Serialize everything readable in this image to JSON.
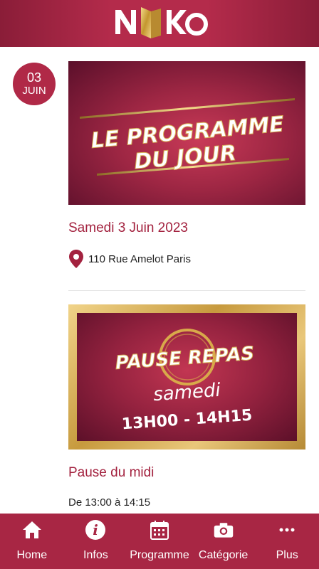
{
  "header": {
    "logo_text": "NIKO",
    "brand_color": "#b02947"
  },
  "date_badge": {
    "day": "03",
    "month": "JUIN"
  },
  "events": [
    {
      "banner_line1": "LE PROGRAMME",
      "banner_line2": "DU JOUR",
      "title": "Samedi 3 Juin 2023",
      "location": "110 Rue Amelot Paris",
      "icon": "map-pin-icon"
    },
    {
      "banner_line1": "PAUSE REPAS",
      "banner_line2": "samedi",
      "banner_line3": "13H00 - 14H15",
      "title": "Pause du midi",
      "time": "De 13:00 à 14:15"
    }
  ],
  "bottom_nav": {
    "items": [
      {
        "label": "Home",
        "icon": "home-icon"
      },
      {
        "label": "Infos",
        "icon": "info-icon"
      },
      {
        "label": "Programme",
        "icon": "calendar-icon"
      },
      {
        "label": "Catégorie",
        "icon": "camera-icon"
      },
      {
        "label": "Plus",
        "icon": "more-icon"
      }
    ]
  }
}
